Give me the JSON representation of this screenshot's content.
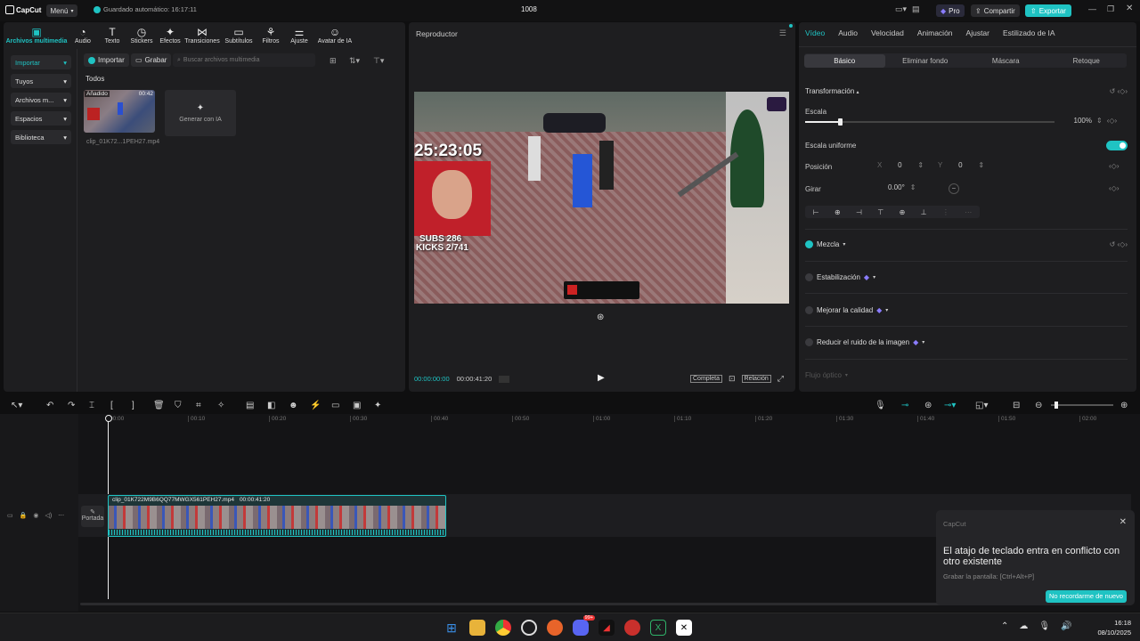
{
  "app": {
    "logo": "CapCut",
    "menu": "Menú",
    "autosave": "Guardado automático: 16:17:11",
    "title": "1008",
    "pro": "Pro",
    "share": "Compartir",
    "export": "Exportar"
  },
  "media_tabs": [
    {
      "label": "Archivos multimedia",
      "icon": "media-icon"
    },
    {
      "label": "Audio",
      "icon": "audio-icon"
    },
    {
      "label": "Texto",
      "icon": "text-icon"
    },
    {
      "label": "Stickers",
      "icon": "stickers-icon"
    },
    {
      "label": "Efectos",
      "icon": "effects-icon"
    },
    {
      "label": "Transiciones",
      "icon": "transitions-icon"
    },
    {
      "label": "Subtítulos",
      "icon": "subtitles-icon"
    },
    {
      "label": "Filtros",
      "icon": "filters-icon"
    },
    {
      "label": "Ajuste",
      "icon": "adjust-icon"
    },
    {
      "label": "Avatar de IA",
      "icon": "avatar-icon"
    }
  ],
  "sidebar": [
    "Importar",
    "Tuyos",
    "Archivos m...",
    "Espacios",
    "Biblioteca"
  ],
  "media": {
    "import": "Importar",
    "record": "Grabar",
    "search_placeholder": "Buscar archivos multimedia",
    "section": "Todos",
    "clip_badge": "Añadido",
    "clip_duration": "00:42",
    "clip_name": "clip_01K72...1PEH27.mp4",
    "ai_generate": "Generar con IA"
  },
  "player": {
    "title": "Reproductor",
    "current": "00:00:00:00",
    "total": "00:00:41:20",
    "full": "Completa",
    "ratio": "Relación"
  },
  "video_overlay": {
    "timer": "25:23:05",
    "subs": "SUBS 286",
    "kicks": "KICKS 2/741"
  },
  "inspector": {
    "tabs": [
      "Vídeo",
      "Audio",
      "Velocidad",
      "Animación",
      "Ajustar",
      "Estilizado de IA"
    ],
    "subtabs": [
      "Básico",
      "Eliminar fondo",
      "Máscara",
      "Retoque"
    ],
    "transform": "Transformación",
    "scale_label": "Escala",
    "scale_value": "100%",
    "scale_level": 0.14,
    "uniform": "Escala uniforme",
    "position": "Posición",
    "x_label": "X",
    "x_value": "0",
    "y_label": "Y",
    "y_value": "0",
    "rotate": "Girar",
    "rotate_value": "0.00°",
    "blend": "Mezcla",
    "stabilize": "Estabilización",
    "quality": "Mejorar la calidad",
    "noise": "Reducir el ruido de la imagen",
    "flow": "Flujo óptico"
  },
  "timeline": {
    "ticks": [
      "00:00",
      "00:10",
      "00:20",
      "00:30",
      "00:40",
      "00:50",
      "01:00",
      "01:10",
      "01:20",
      "01:30",
      "01:40",
      "01:50",
      "02:00"
    ],
    "clip_label": "clip_01K722M9B6QQ77MWGX561PEH27.mp4",
    "clip_duration": "00:00:41:20",
    "cover": "Portada"
  },
  "toast": {
    "brand": "CapCut",
    "message": "El atajo de teclado entra en conflicto con otro existente",
    "detail": "Grabar la pantalla: [Ctrl+Alt+P]",
    "button": "No recordarme de nuevo"
  },
  "taskbar": {
    "time": "16:18",
    "date": "08/10/2025",
    "badge": "99+"
  }
}
